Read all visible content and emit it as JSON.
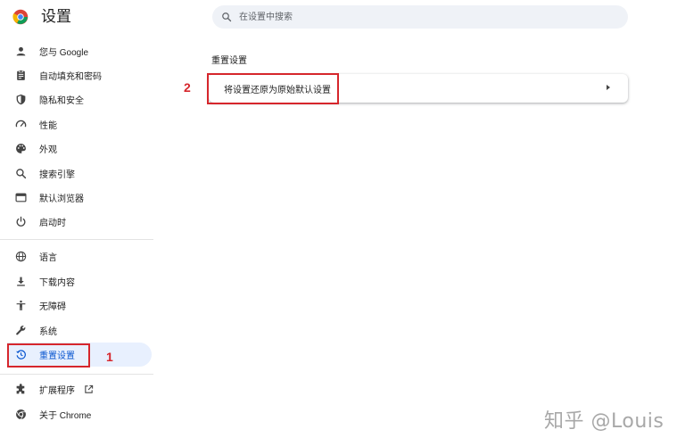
{
  "app": {
    "title": "设置"
  },
  "search": {
    "placeholder": "在设置中搜索"
  },
  "sidebar": {
    "items": [
      {
        "label": "您与 Google",
        "icon": "person-icon"
      },
      {
        "label": "自动填充和密码",
        "icon": "clipboard-icon"
      },
      {
        "label": "隐私和安全",
        "icon": "shield-icon"
      },
      {
        "label": "性能",
        "icon": "speedometer-icon"
      },
      {
        "label": "外观",
        "icon": "palette-icon"
      },
      {
        "label": "搜索引擎",
        "icon": "search-icon"
      },
      {
        "label": "默认浏览器",
        "icon": "browser-icon"
      },
      {
        "label": "启动时",
        "icon": "power-icon"
      },
      {
        "label": "语言",
        "icon": "globe-icon"
      },
      {
        "label": "下载内容",
        "icon": "download-icon"
      },
      {
        "label": "无障碍",
        "icon": "accessibility-icon"
      },
      {
        "label": "系统",
        "icon": "wrench-icon"
      },
      {
        "label": "重置设置",
        "icon": "history-icon",
        "active": true
      },
      {
        "label": "扩展程序",
        "icon": "puzzle-icon",
        "external": true
      },
      {
        "label": "关于 Chrome",
        "icon": "chrome-icon"
      }
    ]
  },
  "main": {
    "section_title": "重置设置",
    "row_label": "将设置还原为原始默认设置"
  },
  "annotations": {
    "step1": "1",
    "step2": "2"
  },
  "watermark": "知乎 @Louis",
  "colors": {
    "accent": "#0b57d0",
    "active_bg": "#e8f0fe",
    "annotation": "#d6262c",
    "search_bg": "#eff2f7"
  }
}
